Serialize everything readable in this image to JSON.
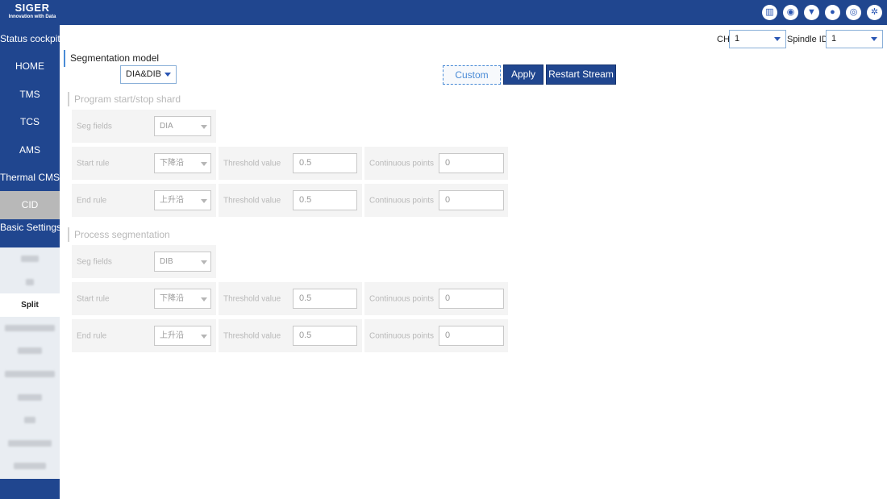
{
  "brand": {
    "name": "SIGER",
    "tagline": "Innovation with Data"
  },
  "top_icons": [
    "chart-icon",
    "camera-icon",
    "shirt-icon",
    "bell-icon",
    "target-icon",
    "settings-icon"
  ],
  "sidebar": {
    "items": [
      "Status cockpit",
      "HOME",
      "TMS",
      "TCS",
      "AMS",
      "Thermal CMS",
      "CID",
      "Basic Settings"
    ],
    "active": "CID",
    "selected_sub": "Split"
  },
  "header": {
    "ch_label": "CH",
    "ch_value": "1",
    "spindle_label": "Spindle ID",
    "spindle_value": "1"
  },
  "segmentation": {
    "title": "Segmentation model",
    "model_value": "DIA&DIB",
    "custom_label": "Custom",
    "apply_label": "Apply",
    "restart_label": "Restart Stream"
  },
  "program_section": {
    "title": "Program start/stop shard",
    "seg_fields_label": "Seg fields",
    "seg_fields_value": "DIA",
    "start_rule_label": "Start rule",
    "start_rule_value": "下降沿",
    "end_rule_label": "End rule",
    "end_rule_value": "上升沿",
    "threshold_label": "Threshold value",
    "start_threshold": "0.5",
    "end_threshold": "0.5",
    "continuous_label": "Continuous points",
    "start_points": "0",
    "end_points": "0"
  },
  "process_section": {
    "title": "Process segmentation",
    "seg_fields_label": "Seg fields",
    "seg_fields_value": "DIB",
    "start_rule_label": "Start rule",
    "start_rule_value": "下降沿",
    "end_rule_label": "End rule",
    "end_rule_value": "上升沿",
    "threshold_label": "Threshold value",
    "start_threshold": "0.5",
    "end_threshold": "0.5",
    "continuous_label": "Continuous points",
    "start_points": "0",
    "end_points": "0"
  },
  "colors": {
    "primary": "#20468f",
    "accent": "#4a8bd6",
    "active_nav": "#b8b8b8"
  }
}
